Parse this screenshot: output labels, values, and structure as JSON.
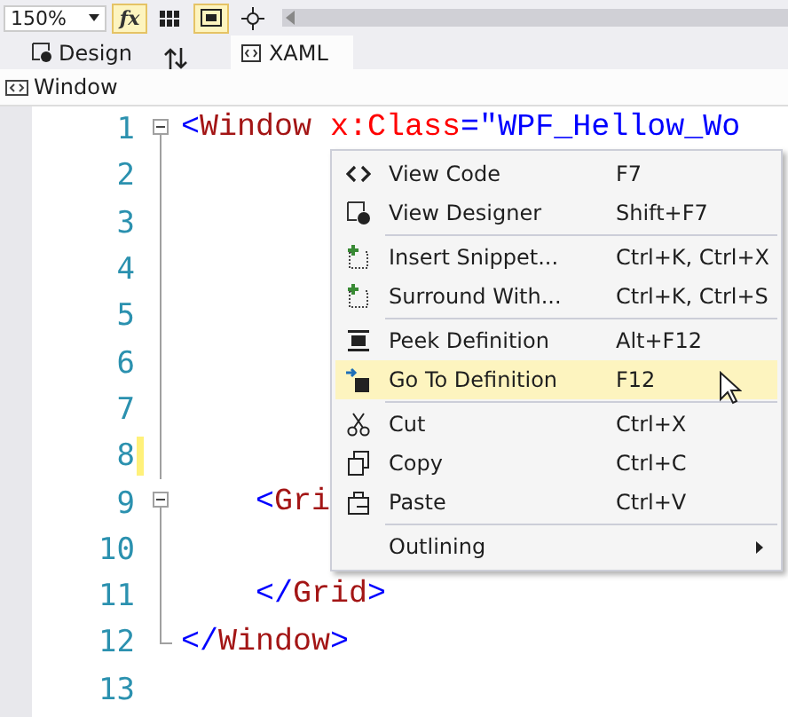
{
  "toolbar": {
    "zoom": "150%",
    "buttons": [
      {
        "kind": "fx",
        "label": "fx",
        "selected": true
      },
      {
        "kind": "grid",
        "selected": false
      },
      {
        "kind": "snap",
        "selected": true
      },
      {
        "kind": "crosshair",
        "selected": false
      }
    ]
  },
  "tabs": [
    {
      "label": "Design",
      "selected": false
    },
    {
      "label": "XAML",
      "selected": true
    }
  ],
  "breadcrumb": "Window",
  "editor": {
    "lines": [
      {
        "number": "1",
        "collapsed": false,
        "changed": false,
        "tokens": [
          {
            "kind": "punct",
            "text": "<"
          },
          {
            "kind": "tag",
            "text": "Window"
          },
          {
            "kind": "attr",
            "text": "x:Class"
          },
          {
            "kind": "punct",
            "text": "=\""
          },
          {
            "kind": "value",
            "text": "WPF_Hellow_Wo"
          }
        ]
      },
      {
        "number": "2",
        "changed": false
      },
      {
        "number": "3",
        "changed": false
      },
      {
        "number": "4",
        "changed": false
      },
      {
        "number": "5",
        "changed": false
      },
      {
        "number": "6",
        "changed": false
      },
      {
        "number": "7",
        "changed": false
      },
      {
        "number": "8",
        "changed": true
      },
      {
        "number": "9",
        "collapsed": false,
        "indented": true,
        "changed": false,
        "tokens": [
          {
            "kind": "punct",
            "text": "<"
          },
          {
            "kind": "tag",
            "text": "Gri"
          }
        ]
      },
      {
        "number": "10",
        "changed": false
      },
      {
        "number": "11",
        "indented": true,
        "changed": false,
        "tokens": [
          {
            "kind": "punct",
            "text": "</"
          },
          {
            "kind": "tag",
            "text": "Grid"
          },
          {
            "kind": "punct",
            "text": ">"
          }
        ]
      },
      {
        "number": "12",
        "block_end": true,
        "changed": false,
        "tokens": [
          {
            "kind": "punct",
            "text": "</"
          },
          {
            "kind": "tag",
            "text": "Window"
          },
          {
            "kind": "punct",
            "text": ">"
          }
        ]
      },
      {
        "number": "13",
        "changed": false
      }
    ]
  },
  "context_menu": {
    "items": [
      {
        "kind": "item",
        "label": "View Code",
        "shortcut": "F7",
        "selected": false
      },
      {
        "kind": "item",
        "label": "View Designer",
        "shortcut": "Shift+F7",
        "selected": false
      },
      {
        "kind": "separator"
      },
      {
        "kind": "item",
        "label": "Insert Snippet...",
        "shortcut": "Ctrl+K, Ctrl+X",
        "selected": false
      },
      {
        "kind": "item",
        "label": "Surround With...",
        "shortcut": "Ctrl+K, Ctrl+S",
        "selected": false
      },
      {
        "kind": "separator"
      },
      {
        "kind": "item",
        "label": "Peek Definition",
        "shortcut": "Alt+F12",
        "selected": false
      },
      {
        "kind": "item",
        "label": "Go To Definition",
        "shortcut": "F12",
        "selected": true
      },
      {
        "kind": "separator"
      },
      {
        "kind": "item",
        "label": "Cut",
        "shortcut": "Ctrl+X",
        "selected": false
      },
      {
        "kind": "item",
        "label": "Copy",
        "shortcut": "Ctrl+C",
        "selected": false
      },
      {
        "kind": "item",
        "label": "Paste",
        "shortcut": "Ctrl+V",
        "selected": false
      },
      {
        "kind": "separator"
      },
      {
        "kind": "submenu",
        "label": "Outlining",
        "selected": false
      }
    ]
  }
}
